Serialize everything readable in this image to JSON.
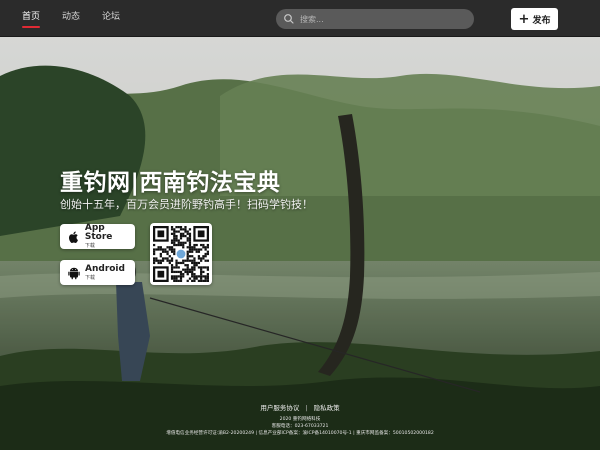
{
  "nav": {
    "items": [
      {
        "label": "首页",
        "active": true
      },
      {
        "label": "动态",
        "active": false
      },
      {
        "label": "论坛",
        "active": false
      }
    ],
    "search_placeholder": "搜索...",
    "publish_label": "发布"
  },
  "hero": {
    "title": "重钓网|西南钓法宝典",
    "subtitle": "创始十五年，百万会员进阶野钓高手！扫码学钓技！"
  },
  "downloads": {
    "appstore": {
      "name": "App Store",
      "sub": "下载",
      "icon": "apple-icon"
    },
    "android": {
      "name": "Android",
      "sub": "下载",
      "icon": "android-icon"
    },
    "qr_icon": "qr-code"
  },
  "footer": {
    "links": [
      "用户服务协议",
      "隐私政策"
    ],
    "company": "2020 重钓网络科技",
    "hotline": "客服电话：023-67033721",
    "license": "增值电信业务经营许可证:渝B2-20200249 | 信息产业部ICP备案：渝ICP备14010070号-1 | 重庆市网监备案：50010502000182"
  },
  "colors": {
    "accent": "#e02a34",
    "navbar_bg": "#2b2b2b",
    "search_bg": "#5a5a5a"
  }
}
